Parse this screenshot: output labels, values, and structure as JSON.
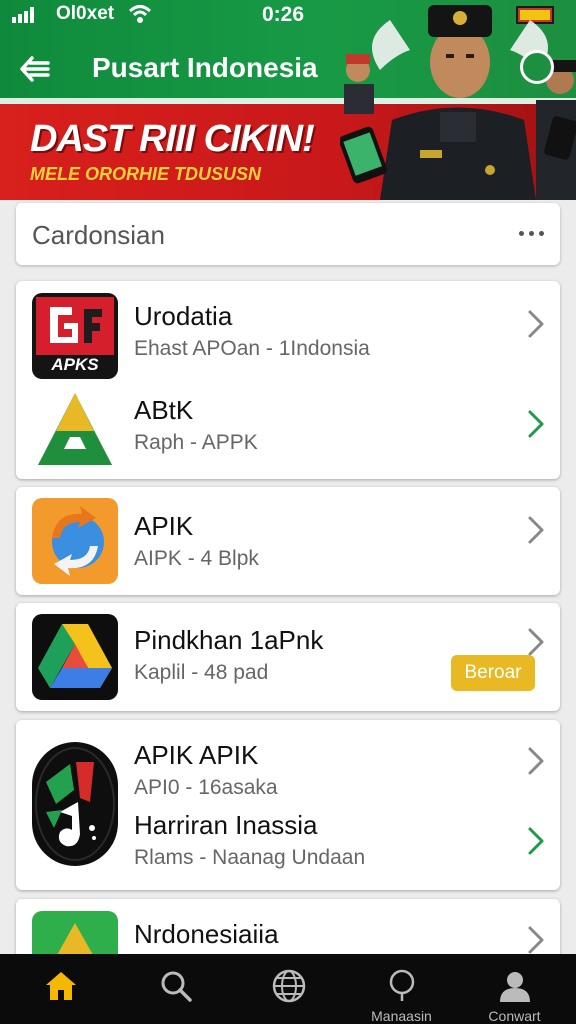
{
  "status_bar": {
    "carrier": "Ol0xet",
    "time": "0:26"
  },
  "header": {
    "title": "Pusart Indonesia",
    "banner_headline": "DAST RIII CIKIN!",
    "banner_subtitle": "MELE ORORHIE TDUSUSN"
  },
  "search": {
    "text": "Cardonsian"
  },
  "apps": [
    {
      "name": "Urodatia",
      "subtitle": "Ehast APOan - 1Indonsia",
      "icon_label": "APKS"
    },
    {
      "name": "ABtK",
      "subtitle": "Raph - APPK"
    },
    {
      "name": "APIK",
      "subtitle": "AIPK - 4 Blpk"
    },
    {
      "name": "Pindkhan 1aPnk",
      "subtitle": "Kaplil - 48 pad",
      "badge": "Beroar"
    },
    {
      "name": "APIK APIK",
      "subtitle": "API0 - 16asaka"
    },
    {
      "name": "Harriran Inassia",
      "subtitle": "Rlams - Naanag Undaan"
    },
    {
      "name": "Nrdonesiaiia",
      "subtitle": ""
    }
  ],
  "bottom_nav": [
    {
      "label": "",
      "icon": "home-icon"
    },
    {
      "label": "",
      "icon": "search-icon"
    },
    {
      "label": "",
      "icon": "globe-icon"
    },
    {
      "label": "Manaasin",
      "icon": "pin-icon"
    },
    {
      "label": "Conwart",
      "icon": "profile-icon"
    }
  ],
  "colors": {
    "header_green": "#179a45",
    "banner_red": "#d8201c",
    "chevron_green": "#1d9a4a",
    "badge_yellow": "#e8b923",
    "home_active": "#f5b800"
  }
}
